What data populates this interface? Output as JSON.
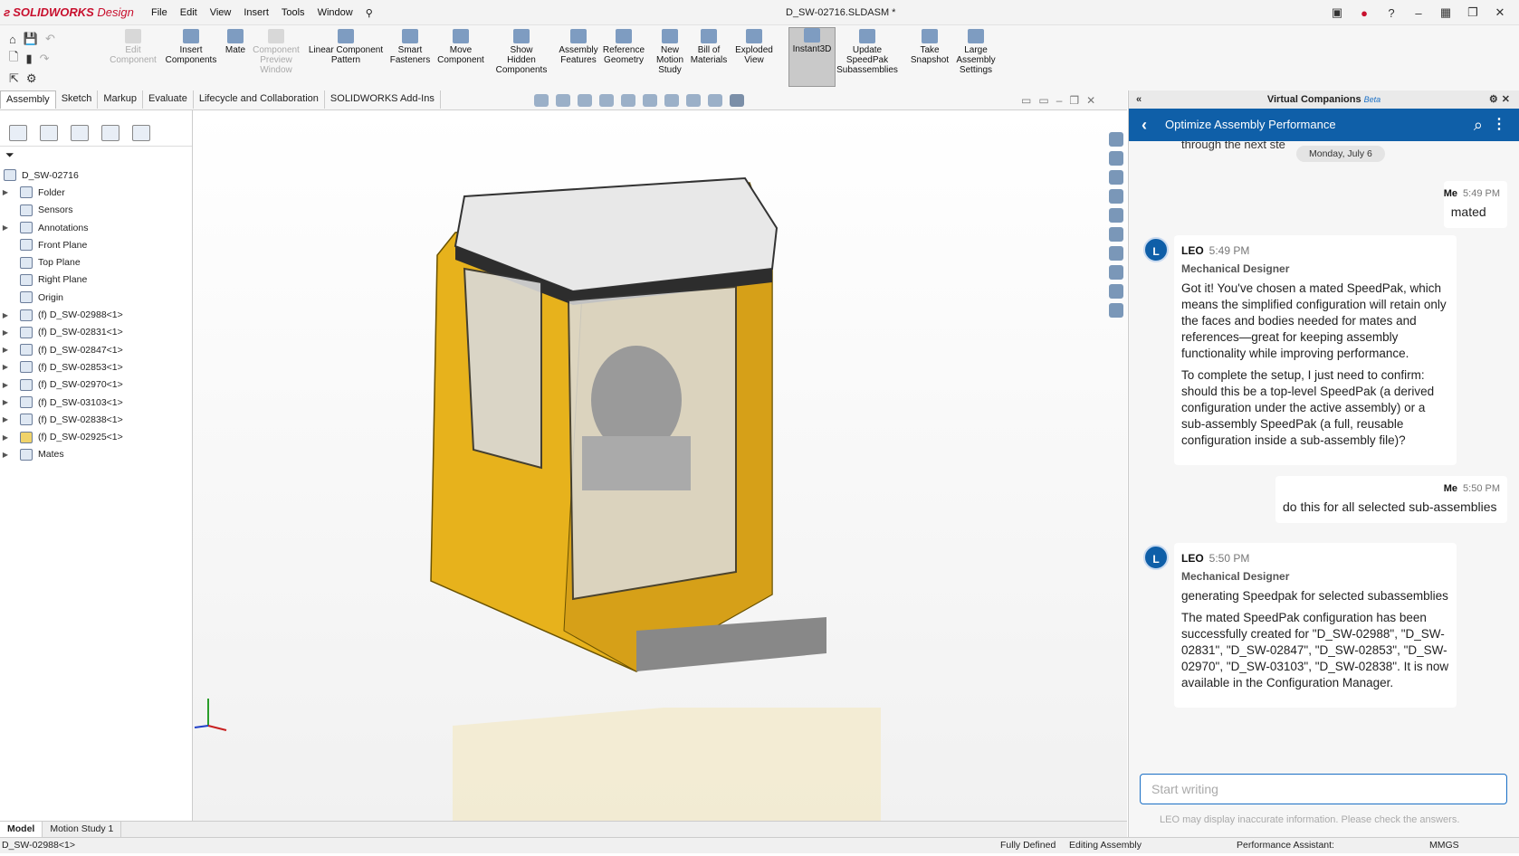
{
  "app": {
    "brand": "SOLIDWORKS",
    "brand_suffix": "Design",
    "document_title": "D_SW-02716.SLDASM *"
  },
  "menu": [
    "File",
    "Edit",
    "View",
    "Insert",
    "Tools",
    "Window"
  ],
  "ribbon": [
    {
      "label": "Edit\nComponent",
      "enabled": false
    },
    {
      "label": "Insert\nComponents",
      "enabled": true
    },
    {
      "label": "Mate",
      "enabled": true
    },
    {
      "label": "Component\nPreview\nWindow",
      "enabled": false
    },
    {
      "label": "Linear Component\nPattern",
      "enabled": true
    },
    {
      "label": "Smart\nFasteners",
      "enabled": true
    },
    {
      "label": "Move\nComponent",
      "enabled": true
    },
    {
      "label": "Show\nHidden\nComponents",
      "enabled": true
    },
    {
      "label": "Assembly\nFeatures",
      "enabled": true
    },
    {
      "label": "Reference\nGeometry",
      "enabled": true
    },
    {
      "label": "New\nMotion\nStudy",
      "enabled": true
    },
    {
      "label": "Bill of\nMaterials",
      "enabled": true
    },
    {
      "label": "Exploded\nView",
      "enabled": true
    },
    {
      "label": "Instant3D",
      "enabled": true,
      "active": true
    },
    {
      "label": "Update\nSpeedPak\nSubassemblies",
      "enabled": true
    },
    {
      "label": "Take\nSnapshot",
      "enabled": true
    },
    {
      "label": "Large\nAssembly\nSettings",
      "enabled": true
    }
  ],
  "tabs": [
    "Assembly",
    "Sketch",
    "Markup",
    "Evaluate",
    "Lifecycle and Collaboration",
    "SOLIDWORKS Add-Ins"
  ],
  "tree": {
    "root": "D_SW-02716",
    "items": [
      "Folder",
      "Sensors",
      "Annotations",
      "Front Plane",
      "Top Plane",
      "Right Plane",
      "Origin",
      "(f) D_SW-02988<1>",
      "(f) D_SW-02831<1>",
      "(f) D_SW-02847<1>",
      "(f) D_SW-02853<1>",
      "(f) D_SW-02970<1>",
      "(f) D_SW-03103<1>",
      "(f) D_SW-02838<1>",
      "(f) D_SW-02925<1>",
      "Mates"
    ]
  },
  "bottom_tabs": [
    "Model",
    "Motion Study 1"
  ],
  "status": {
    "selected": "D_SW-02988<1>",
    "state": "Fully Defined",
    "mode": "Editing Assembly",
    "assistant": "Performance Assistant:",
    "units": "MMGS"
  },
  "chat": {
    "panel_title": "Virtual Companions",
    "beta": "Beta",
    "topic": "Optimize Assembly Performance",
    "cutoff_text": "through the next ste",
    "date": "Monday, July 6",
    "messages": {
      "m1": {
        "who": "Me",
        "time": "5:49 PM",
        "text": "mated"
      },
      "l1": {
        "who": "LEO",
        "time": "5:49 PM",
        "role": "Mechanical Designer",
        "p1": "Got it! You've chosen a mated SpeedPak, which means the simplified configuration will retain only the faces and bodies needed for mates and references—great for keeping assembly functionality while improving performance.",
        "p2": "To complete the setup, I just need to confirm: should this be a top-level SpeedPak (a derived configuration under the active assembly) or a sub-assembly SpeedPak (a full, reusable configuration inside a sub-assembly file)?"
      },
      "m2": {
        "who": "Me",
        "time": "5:50 PM",
        "text": "do this for all selected sub-assemblies"
      },
      "l2": {
        "who": "LEO",
        "time": "5:50 PM",
        "role": "Mechanical Designer",
        "p1": "generating Speedpak for selected subassemblies",
        "p2": "The mated SpeedPak configuration has been successfully created for \"D_SW-02988\", \"D_SW-02831\", \"D_SW-02847\", \"D_SW-02853\", \"D_SW-02970\", \"D_SW-03103\", \"D_SW-02838\". It is now available in the Configuration Manager."
      }
    },
    "input_placeholder": "Start writing",
    "disclaimer": "LEO may display inaccurate information. Please check the answers."
  },
  "colors": {
    "accent": "#0f5fa8",
    "brand": "#c8102e",
    "model": "#e7b21c"
  }
}
